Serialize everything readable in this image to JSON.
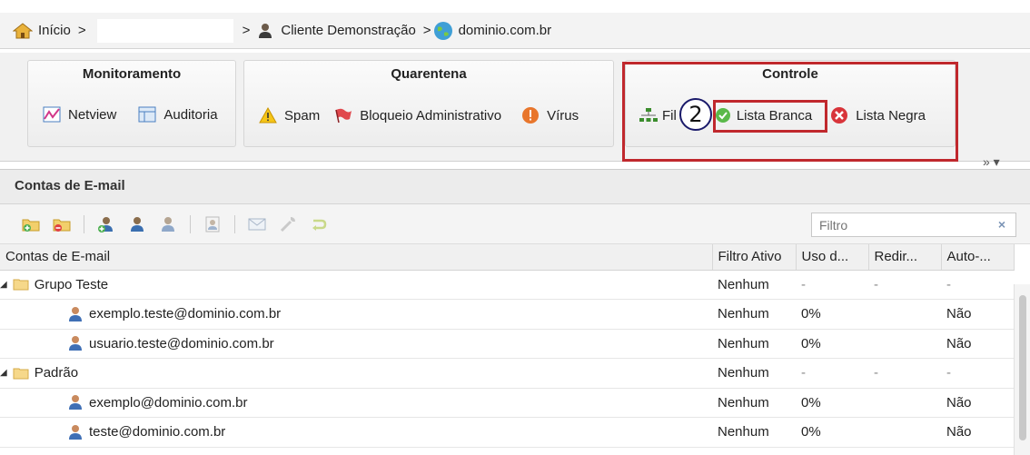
{
  "breadcrumb": {
    "home_label": "Início",
    "sep1": ">",
    "sep2": ">",
    "client_label": "Cliente Demonstração",
    "sep3": ">",
    "domain_label": "dominio.com.br"
  },
  "ribbon": {
    "groups": [
      {
        "title": "Monitoramento",
        "buttons": [
          {
            "label": "Netview",
            "icon": "chart-icon"
          },
          {
            "label": "Auditoria",
            "icon": "table-icon"
          }
        ]
      },
      {
        "title": "Quarentena",
        "buttons": [
          {
            "label": "Spam",
            "icon": "warning-icon"
          },
          {
            "label": "Bloqueio Administrativo",
            "icon": "flag-icon"
          },
          {
            "label": "Vírus",
            "icon": "virus-icon"
          }
        ]
      },
      {
        "title": "Controle",
        "buttons": [
          {
            "label": "Fil",
            "icon": "filter-tree-icon"
          },
          {
            "label": "Lista Branca",
            "icon": "check-icon"
          },
          {
            "label": "Lista Negra",
            "icon": "cross-icon"
          }
        ]
      }
    ],
    "more_label": "»  ▾",
    "step_number": "2"
  },
  "panel": {
    "title": "Contas de E-mail",
    "filter_placeholder": "Filtro",
    "filter_clear": "×",
    "columns": [
      "Contas de E-mail",
      "Filtro Ativo",
      "Uso d...",
      "Redir...",
      "Auto-..."
    ],
    "rows": [
      {
        "type": "group",
        "name": "Grupo Teste",
        "filtro": "Nenhum",
        "uso": "-",
        "redir": "-",
        "auto": "-"
      },
      {
        "type": "account",
        "name": "exemplo.teste@dominio.com.br",
        "filtro": "Nenhum",
        "uso": "0%",
        "redir": "",
        "auto": "Não"
      },
      {
        "type": "account",
        "name": "usuario.teste@dominio.com.br",
        "filtro": "Nenhum",
        "uso": "0%",
        "redir": "",
        "auto": "Não"
      },
      {
        "type": "group",
        "name": "Padrão",
        "filtro": "Nenhum",
        "uso": "-",
        "redir": "-",
        "auto": "-"
      },
      {
        "type": "account",
        "name": "exemplo@dominio.com.br",
        "filtro": "Nenhum",
        "uso": "0%",
        "redir": "",
        "auto": "Não"
      },
      {
        "type": "account",
        "name": "teste@dominio.com.br",
        "filtro": "Nenhum",
        "uso": "0%",
        "redir": "",
        "auto": "Não"
      }
    ]
  },
  "colors": {
    "highlight": "#c0282d",
    "accent": "#2a6bbf"
  }
}
